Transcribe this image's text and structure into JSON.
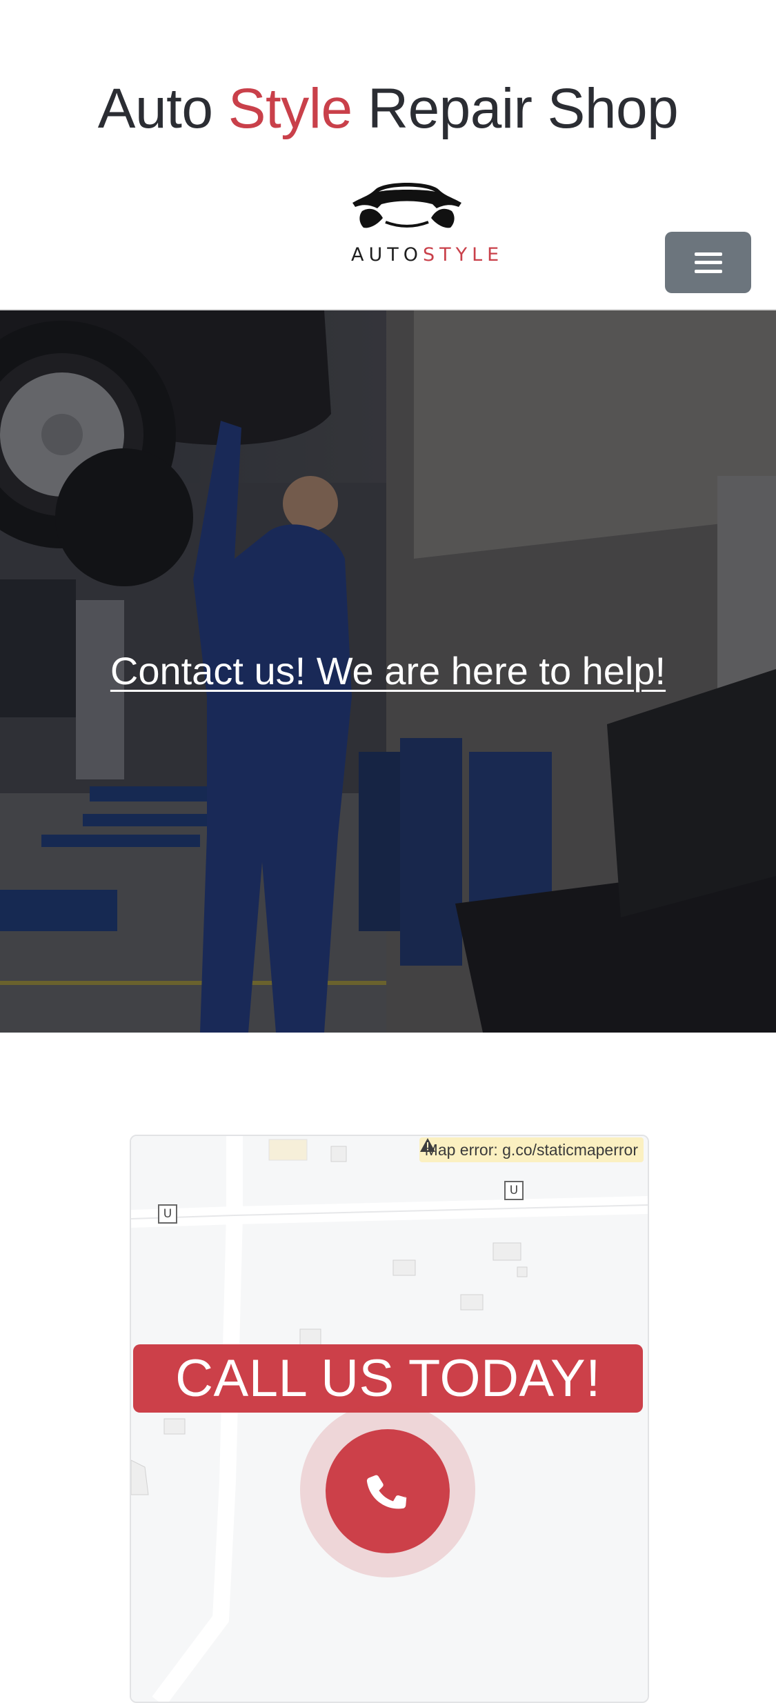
{
  "header": {
    "title_part1": "Auto ",
    "title_accent": "Style",
    "title_part2": " Repair Shop",
    "logo_text_part1": "AUTO",
    "logo_text_part2": "STYLE",
    "menu_icon": "hamburger-icon"
  },
  "hero": {
    "link_text": "Contact us! We are here to help!"
  },
  "map": {
    "error_text": "Map error: g.co/staticmaperror",
    "error_icon": "warning-icon",
    "marker_label": "U"
  },
  "cta": {
    "banner_text": "CALL US TODAY!",
    "phone_icon": "phone-icon"
  },
  "colors": {
    "accent": "#c9404a",
    "menu_button": "#6c757d",
    "title_text": "#2b2d33"
  }
}
